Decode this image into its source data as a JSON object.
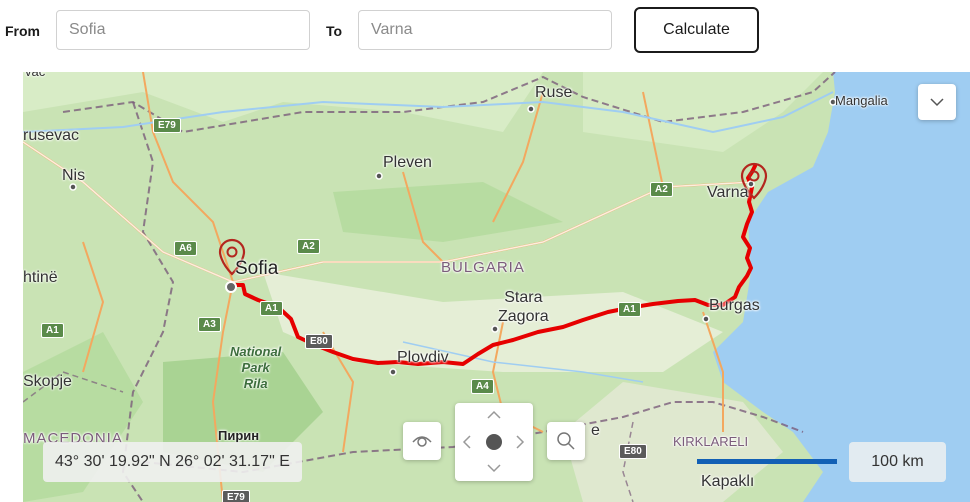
{
  "toolbar": {
    "from_label": "From",
    "from_placeholder": "Sofia",
    "to_label": "To",
    "to_placeholder": "Varna",
    "calculate_label": "Calculate"
  },
  "map": {
    "places": {
      "ruse": "Ruse",
      "mangalia": "Mangalia",
      "krusevac": "rusevac",
      "nis": "Nis",
      "pleven": "Pleven",
      "varna": "Varna",
      "sofia": "Sofia",
      "bulgaria": "BULGARIA",
      "stara_zagora": "Stara\nZagora",
      "burgas": "Burgas",
      "shtine": "htinë",
      "skopje": "Skopje",
      "plovdiv": "Plovdiv",
      "macedonia": "MACEDONIA",
      "pirin": "Пирин",
      "kirklareli": "KIRKLARELI",
      "kapakli": "Kapaklı",
      "top_partial": "vac",
      "park": "National\nPark\nRila",
      "e_partial": "e"
    },
    "shields": {
      "e79_top": "E79",
      "a2_north": "A2",
      "a6": "A6",
      "a2_west": "A2",
      "a1_west": "A1",
      "a1_sofia": "A1",
      "a3": "A3",
      "e80_sofia": "E80",
      "a4": "A4",
      "e80_turkey": "E80",
      "e79_bottom": "E79",
      "a1_east": "A1"
    },
    "coordinates": "43° 30' 19.92\" N 26° 02' 31.17\" E",
    "scale": "100 km",
    "colors": {
      "route": "#e60000",
      "water": "#9fcdf2",
      "land": "#c9e3b4",
      "scale_bar": "#1260b5"
    }
  }
}
